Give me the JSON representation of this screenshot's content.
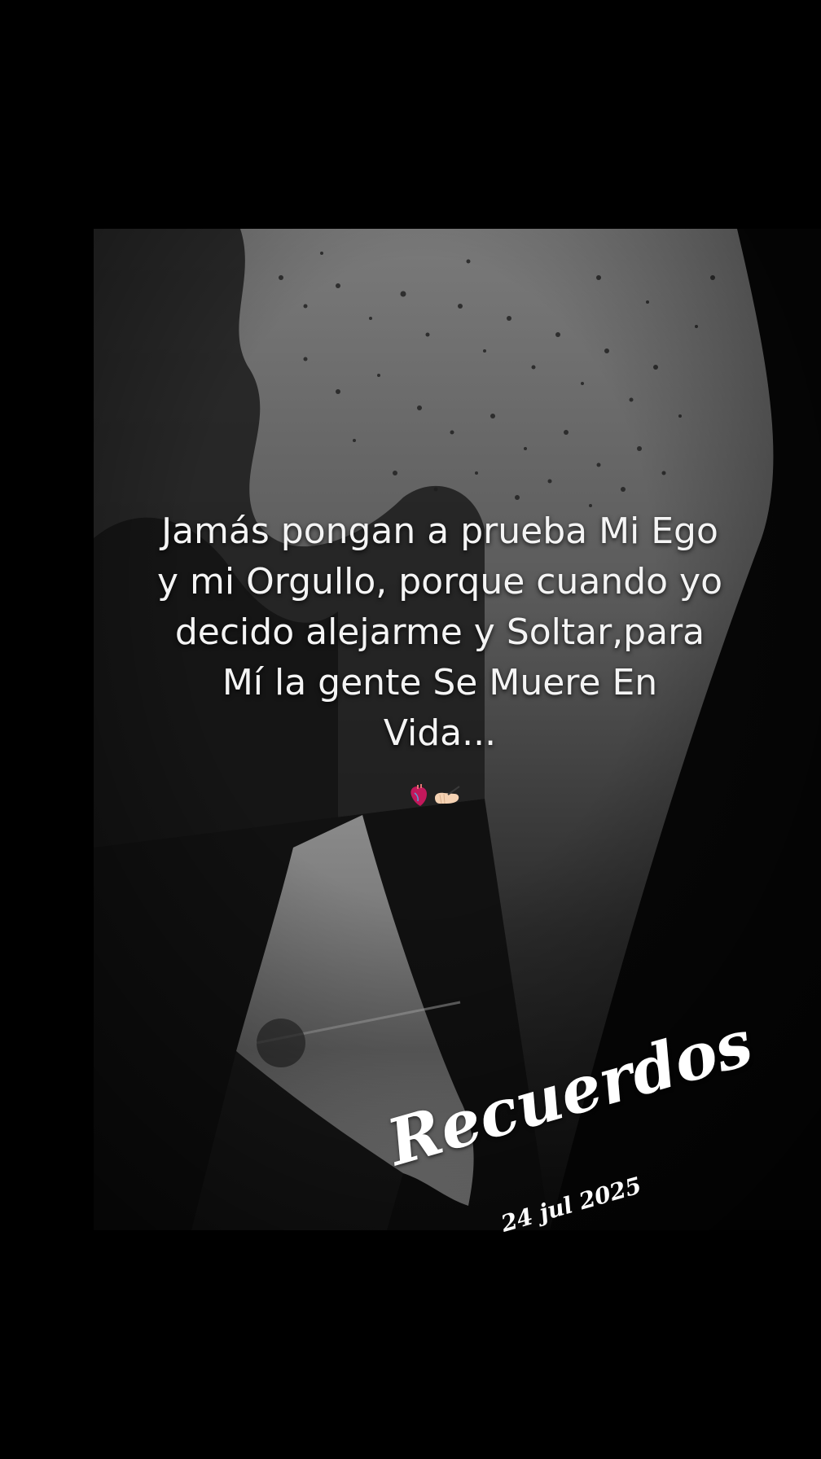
{
  "quote": {
    "lines": [
      "Jamás pongan a prueba Mi Ego",
      "y mi Orgullo, porque cuando yo",
      "decido alejarme y Soltar,para",
      "Mí la gente Se Muere En",
      "Vida..."
    ]
  },
  "emojis": [
    "anatomical-heart-icon",
    "writing-hand-icon"
  ],
  "overlay": {
    "title": "Recuerdos",
    "date": "24 jul 2025"
  },
  "colors": {
    "background": "#000000",
    "text": "#f4f4f4"
  }
}
